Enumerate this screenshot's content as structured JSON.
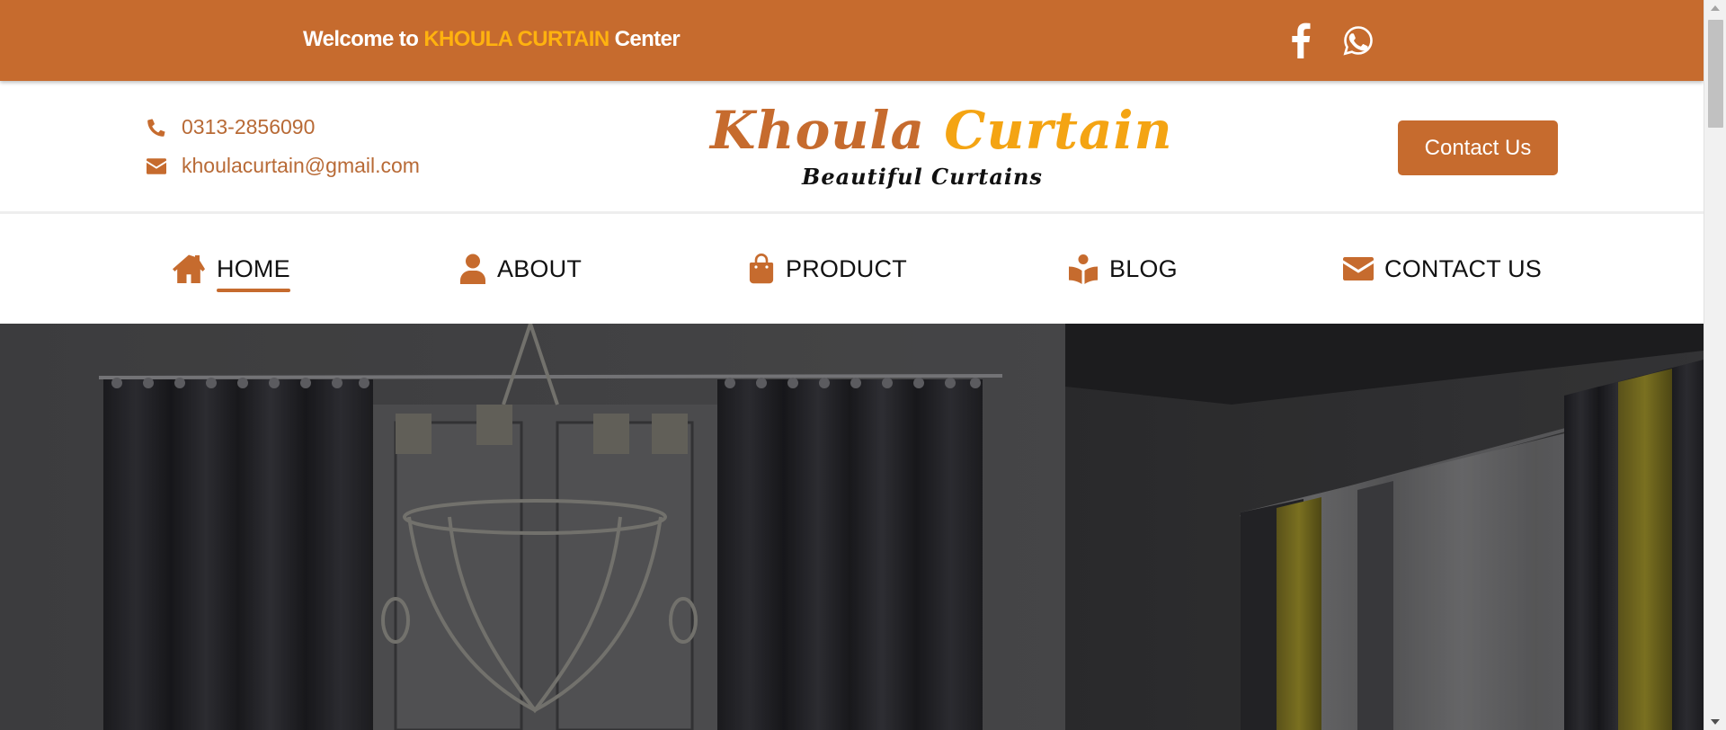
{
  "topbar": {
    "welcome_prefix": "Welcome to ",
    "welcome_brand": "KHOULA CURTAIN",
    "welcome_suffix": " Center",
    "social": [
      {
        "icon": "facebook-icon"
      },
      {
        "icon": "whatsapp-icon"
      }
    ]
  },
  "header": {
    "phone": "0313-2856090",
    "email": "khoulacurtain@gmail.com",
    "logo": {
      "word1": "Khoula",
      "word2": "Curtain",
      "tagline": "Beautiful Curtains"
    },
    "contact_button": "Contact Us"
  },
  "nav": {
    "items": [
      {
        "label": "HOME",
        "icon": "home-icon",
        "active": true
      },
      {
        "label": "ABOUT",
        "icon": "user-icon",
        "active": false
      },
      {
        "label": "PRODUCT",
        "icon": "shopping-bag-icon",
        "active": false
      },
      {
        "label": "BLOG",
        "icon": "book-reader-icon",
        "active": false
      },
      {
        "label": "CONTACT US",
        "icon": "envelope-icon",
        "active": false
      }
    ]
  },
  "colors": {
    "primary": "#c66b2e",
    "brand_yellow": "#ffb20f",
    "logo_yellow": "#f4a413",
    "contact_text": "#b86a36"
  }
}
